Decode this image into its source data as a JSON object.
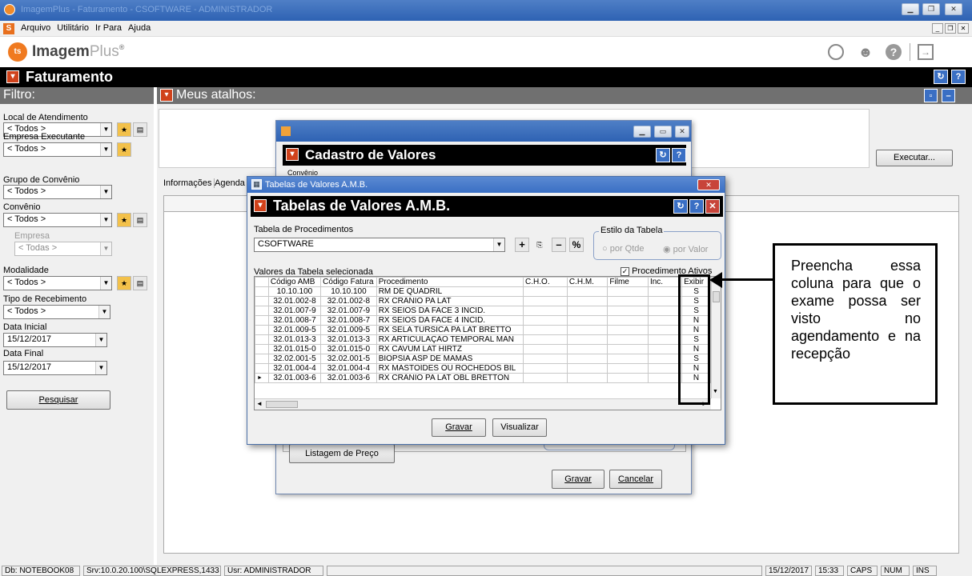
{
  "window": {
    "title": "ImagemPlus - Faturamento - CSOFTWARE - ADMINISTRADOR"
  },
  "menu": [
    "Arquivo",
    "Utilitário",
    "Ir Para",
    "Ajuda"
  ],
  "logo": {
    "text_a": "Imagem",
    "text_b": "Plus",
    "reg": "®"
  },
  "module": {
    "title": "Faturamento"
  },
  "filter": {
    "title": "Filtro:",
    "local_label": "Local de Atendimento",
    "local_value": "< Todos >",
    "empresa_exec_label": "Empresa Executante",
    "empresa_exec_value": "< Todos >",
    "grupo_label": "Grupo de Convênio",
    "grupo_value": "< Todos >",
    "convenio_label": "Convênio",
    "convenio_value": "< Todos >",
    "empresa_label": "Empresa",
    "empresa_value": "< Todas >",
    "modalidade_label": "Modalidade",
    "modalidade_value": "< Todos >",
    "tipo_label": "Tipo de Recebimento",
    "tipo_value": "< Todos >",
    "data_ini_label": "Data Inicial",
    "data_ini_value": "15/12/2017",
    "data_fim_label": "Data Final",
    "data_fim_value": "15/12/2017",
    "search_button": "Pesquisar"
  },
  "shortcuts": {
    "title": "Meus atalhos:"
  },
  "executar_button": "Executar...",
  "tabs": [
    "Informações",
    "Agenda"
  ],
  "cadastro": {
    "title": "Cadastro de Valores",
    "convenio_label": "Convênio",
    "listagem_button": "Listagem de Preço",
    "gravar_button": "Gravar",
    "cancelar_button": "Cancelar"
  },
  "amb": {
    "window_title": "Tabelas de Valores A.M.B.",
    "header": "Tabelas de Valores A.M.B.",
    "tabela_label": "Tabela de Procedimentos",
    "tabela_value": "CSOFTWARE",
    "estilo_label": "Estilo da Tabela",
    "por_qtde": "por Qtde",
    "por_valor": "por Valor",
    "valores_label": "Valores da Tabela selecionada",
    "ativos_label": "Procedimento Ativos",
    "columns": [
      "Código AMB",
      "Código Fatura",
      "Procedimento",
      "C.H.O.",
      "C.H.M.",
      "Filme",
      "Inc.",
      "Exibir"
    ],
    "rows": [
      [
        "10.10.100",
        "10.10.100",
        "RM DE QUADRIL",
        "",
        "",
        "",
        "",
        "S"
      ],
      [
        "32.01.002-8",
        "32.01.002-8",
        "RX CRÂNIO PA LAT",
        "",
        "",
        "",
        "",
        "S"
      ],
      [
        "32.01.007-9",
        "32.01.007-9",
        "RX SEIOS DA FACE 3 INCID.",
        "",
        "",
        "",
        "",
        "S"
      ],
      [
        "32.01.008-7",
        "32.01.008-7",
        "RX SEIOS DA FACE 4 INCID.",
        "",
        "",
        "",
        "",
        "N"
      ],
      [
        "32.01.009-5",
        "32.01.009-5",
        "RX SELA TURSICA PA LAT BRETTO",
        "",
        "",
        "",
        "",
        "N"
      ],
      [
        "32.01.013-3",
        "32.01.013-3",
        "RX ARTICULAÇÃO TEMPORAL MAN",
        "",
        "",
        "",
        "",
        "S"
      ],
      [
        "32.01.015-0",
        "32.01.015-0",
        "RX CAVUM LAT HIRTZ",
        "",
        "",
        "",
        "",
        "N"
      ],
      [
        "32.02.001-5",
        "32.02.001-5",
        "BIOPSIA ASP DE MAMAS",
        "",
        "",
        "",
        "",
        "S"
      ],
      [
        "32.01.004-4",
        "32.01.004-4",
        "RX MASTOÍDES OU ROCHEDOS BIL",
        "",
        "",
        "",
        "",
        "N"
      ],
      [
        "32.01.003-6",
        "32.01.003-6",
        "RX CRÂNIO PA LAT OBL BRETTON",
        "",
        "",
        "",
        "",
        "N"
      ]
    ],
    "gravar_button": "Gravar",
    "visualizar_button": "Visualizar"
  },
  "callout": {
    "text": "Preencha essa coluna para que o exame possa ser visto no agendamento e na recepção"
  },
  "status": {
    "db": "Db: NOTEBOOK08",
    "srv": "Srv:10.0.20.100\\SQLEXPRESS,1433",
    "usr": "Usr: ADMINISTRADOR",
    "date": "15/12/2017",
    "time": "15:33",
    "caps": "CAPS",
    "num": "NUM",
    "ins": "INS"
  }
}
